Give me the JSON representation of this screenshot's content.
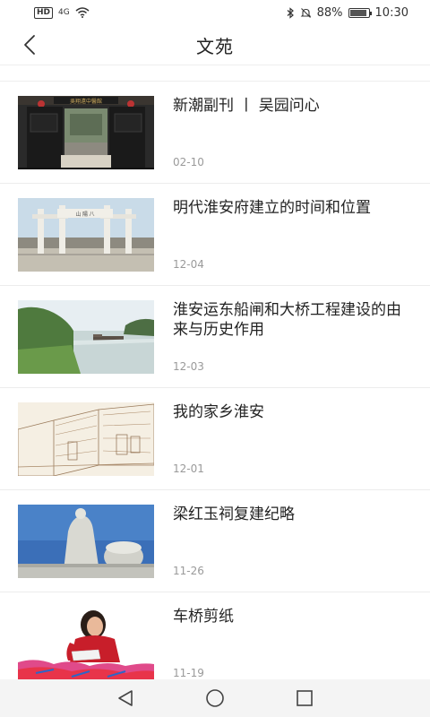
{
  "status_bar": {
    "network_badge": "HD",
    "signal_text": "4G",
    "battery_percent": "88%",
    "battery_level": 0.88,
    "time": "10:30",
    "icons": [
      "hd-badge",
      "signal-icon",
      "wifi-icon",
      "bluetooth-icon",
      "mute-icon",
      "battery-icon"
    ]
  },
  "header": {
    "title": "文苑",
    "back_icon": "back-icon"
  },
  "articles": [
    {
      "title": "新潮副刊 丨 吴园问心",
      "date": "02-10",
      "thumb": "gate-courtyard"
    },
    {
      "title": "明代淮安府建立的时间和位置",
      "date": "12-04",
      "thumb": "stone-archway"
    },
    {
      "title": "淮安运东船闸和大桥工程建设的由来与历史作用",
      "date": "12-03",
      "thumb": "river-barge"
    },
    {
      "title": "我的家乡淮安",
      "date": "12-01",
      "thumb": "street-sketch"
    },
    {
      "title": "梁红玉祠复建纪略",
      "date": "11-26",
      "thumb": "statue-drum"
    },
    {
      "title": "车桥剪纸",
      "date": "11-19",
      "thumb": "paper-cutting"
    }
  ],
  "colors": {
    "text": "#222222",
    "date": "#9a9a9a",
    "divider": "#ececec",
    "nav_bg": "#f4f4f4"
  }
}
